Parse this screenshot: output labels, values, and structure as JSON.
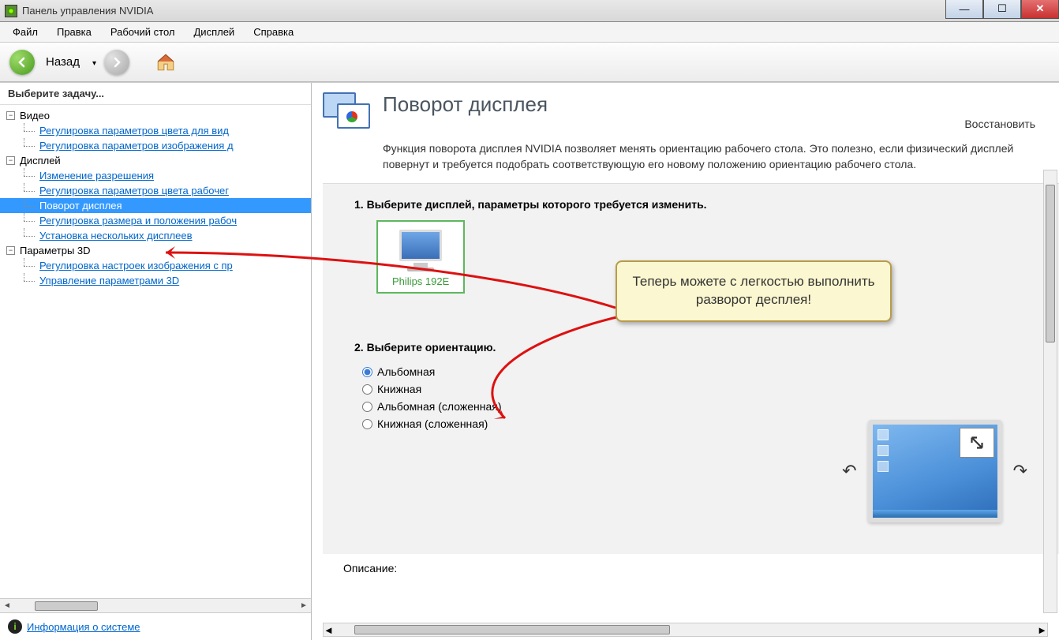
{
  "window": {
    "title": "Панель управления NVIDIA"
  },
  "menu": {
    "items": [
      "Файл",
      "Правка",
      "Рабочий стол",
      "Дисплей",
      "Справка"
    ]
  },
  "toolbar": {
    "back": "Назад"
  },
  "sidebar": {
    "header": "Выберите задачу...",
    "groups": [
      {
        "label": "Видео",
        "children": [
          "Регулировка параметров цвета для вид",
          "Регулировка параметров изображения д"
        ]
      },
      {
        "label": "Дисплей",
        "children": [
          "Изменение разрешения",
          "Регулировка параметров цвета рабочег",
          "Поворот дисплея",
          "Регулировка размера и положения рабоч",
          "Установка нескольких дисплеев"
        ],
        "selectedIndex": 2
      },
      {
        "label": "Параметры 3D",
        "children": [
          "Регулировка настроек изображения с пр",
          "Управление параметрами 3D"
        ]
      }
    ],
    "sysinfo": "Информация о системе"
  },
  "main": {
    "title": "Поворот дисплея",
    "restore": "Восстановить",
    "description": "Функция поворота дисплея NVIDIA позволяет менять ориентацию рабочего стола. Это полезно, если физический дисплей повернут и требуется подобрать соответствующую его новому положению ориентацию рабочего стола.",
    "step1": "1. Выберите дисплей, параметры которого требуется изменить.",
    "monitor": "Philips 192E",
    "step2": "2. Выберите ориентацию.",
    "orientations": [
      "Альбомная",
      "Книжная",
      "Альбомная (сложенная)",
      "Книжная (сложенная)"
    ],
    "selectedOrientation": 0,
    "descLabel": "Описание:"
  },
  "callout": "Теперь можете с легкостью выполнить разворот десплея!"
}
